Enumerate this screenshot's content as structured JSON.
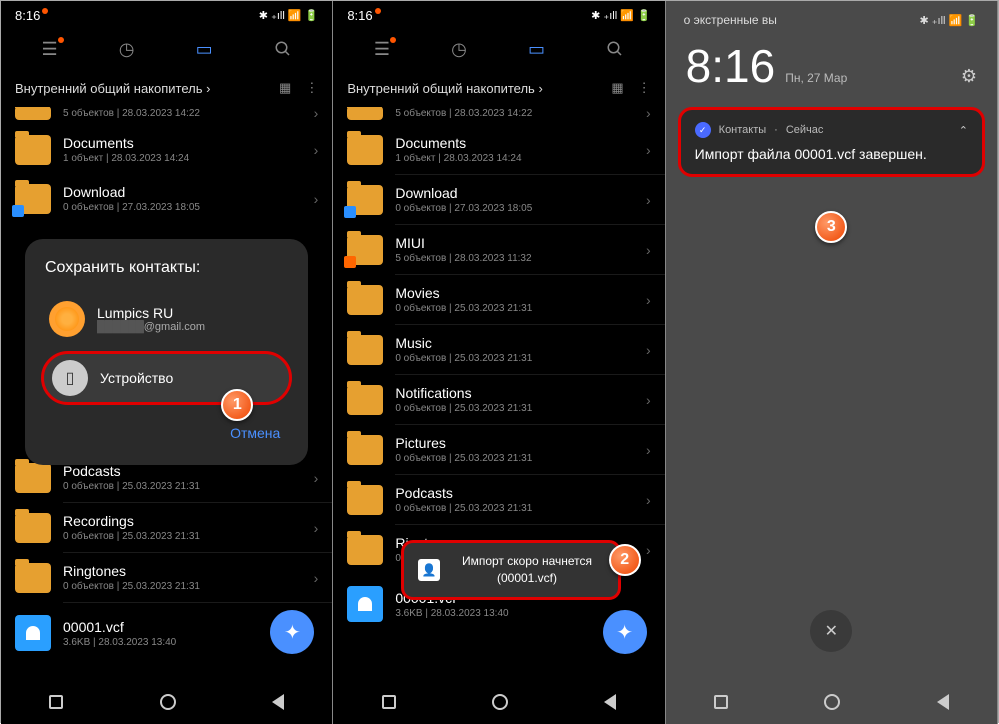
{
  "status": {
    "time": "8:16",
    "icons": "✱ ull ⚡ ⏻"
  },
  "breadcrumb": "Внутренний общий накопитель",
  "dialog": {
    "title": "Сохранить контакты:",
    "account_name": "Lumpics RU",
    "account_email": "@gmail.com",
    "device": "Устройство",
    "cancel": "Отмена"
  },
  "panel1": [
    {
      "name": "",
      "sub": "5 объектов | 28.03.2023 14:22"
    },
    {
      "name": "Documents",
      "sub": "1 объект | 28.03.2023 14:24"
    },
    {
      "name": "Download",
      "sub": "0 объектов | 27.03.2023 18:05",
      "badge": "blue"
    },
    {
      "name": "Podcasts",
      "sub": "0 объектов | 25.03.2023 21:31"
    },
    {
      "name": "Recordings",
      "sub": "0 объектов | 25.03.2023 21:31"
    },
    {
      "name": "Ringtones",
      "sub": "0 объектов | 25.03.2023 21:31"
    }
  ],
  "panel2": [
    {
      "name": "",
      "sub": "5 объектов | 28.03.2023 14:22"
    },
    {
      "name": "Documents",
      "sub": "1 объект | 28.03.2023 14:24"
    },
    {
      "name": "Download",
      "sub": "0 объектов | 27.03.2023 18:05",
      "badge": "blue"
    },
    {
      "name": "MIUI",
      "sub": "5 объектов | 28.03.2023 11:32",
      "badge": "org"
    },
    {
      "name": "Movies",
      "sub": "0 объектов | 25.03.2023 21:31"
    },
    {
      "name": "Music",
      "sub": "0 объектов | 25.03.2023 21:31"
    },
    {
      "name": "Notifications",
      "sub": "0 объектов | 25.03.2023 21:31"
    },
    {
      "name": "Pictures",
      "sub": "0 объектов | 25.03.2023 21:31"
    },
    {
      "name": "Podcasts",
      "sub": "0 объектов | 25.03.2023 21:31"
    },
    {
      "name": "Ringtones",
      "sub": "0 объектов | 25.03.2023 21:31"
    }
  ],
  "vcf": {
    "name": "00001.vcf",
    "sub": "3.6KB | 28.03.2023 13:40"
  },
  "toast": {
    "line1": "Импорт скоро начнется",
    "line2": "(00001.vcf)"
  },
  "lock": {
    "marquee": "о экстренные вы",
    "time": "8:16",
    "date": "Пн, 27 Мар"
  },
  "notif": {
    "app": "Контакты",
    "when": "Сейчас",
    "body": "Импорт файла 00001.vcf завершен."
  },
  "badges": {
    "b1": "1",
    "b2": "2",
    "b3": "3"
  }
}
